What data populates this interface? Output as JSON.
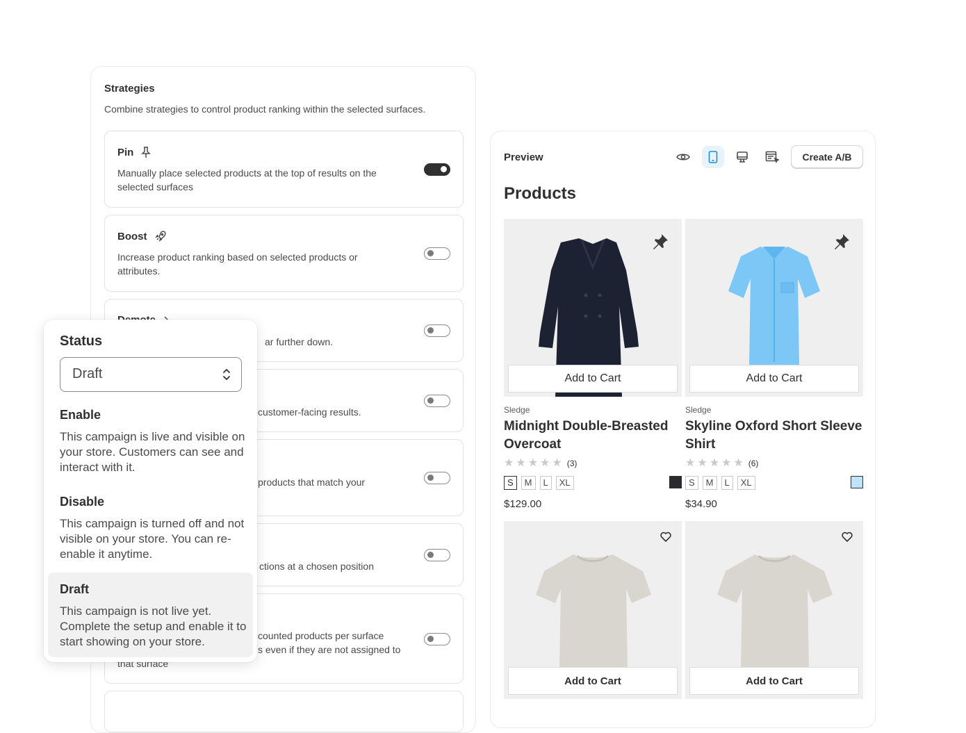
{
  "strategies": {
    "title": "Strategies",
    "subtitle": "Combine strategies to control product ranking within the selected surfaces.",
    "items": [
      {
        "name": "Pin",
        "icon": "pin-icon",
        "desc1": "Manually place selected products at the top of results on the",
        "desc2": "selected surfaces",
        "enabled": true
      },
      {
        "name": "Boost",
        "icon": "rocket-icon",
        "desc1": "Increase product ranking based on selected products or",
        "desc2": "attributes.",
        "enabled": false
      },
      {
        "name": "Demote",
        "icon": "demote-icon",
        "desc1": "ar further down.",
        "enabled": false
      },
      {
        "desc1": "customer-facing results.",
        "enabled": false
      },
      {
        "desc1": "products that match your",
        "enabled": false
      },
      {
        "desc1": "ctions at a chosen position",
        "enabled": false
      },
      {
        "desc1": "counted products per surface",
        "desc2": "s even if they are not assigned to",
        "desc3": "that surface",
        "enabled": false
      }
    ]
  },
  "status": {
    "label": "Status",
    "selected": "Draft",
    "options": [
      {
        "title": "Enable",
        "desc": "This campaign is live and visible on your store. Customers can see and interact with it."
      },
      {
        "title": "Disable",
        "desc": "This campaign is turned off and not visible on your store. You can re-enable it anytime."
      },
      {
        "title": "Draft",
        "desc": "This campaign is not live yet. Complete the setup and enable it to start showing on your store."
      }
    ]
  },
  "preview": {
    "title": "Preview",
    "tools": [
      "eye-icon",
      "mobile-icon",
      "desktop-icon",
      "storefront-icon"
    ],
    "active_tool": "mobile-icon",
    "ab_button": "Create A/B",
    "products_heading": "Products",
    "products": [
      {
        "vendor": "Sledge",
        "name": "Midnight Double-Breasted Overcoat",
        "rating_count": "(3)",
        "sizes": [
          "S",
          "M",
          "L",
          "XL"
        ],
        "selected_size": "S",
        "swatch": "#2b2b2f",
        "price": "$129.00",
        "cta": "Add to Cart"
      },
      {
        "vendor": "Sledge",
        "name": "Skyline Oxford Short Sleeve Shirt",
        "rating_count": "(6)",
        "sizes": [
          "S",
          "M",
          "L",
          "XL"
        ],
        "swatch": "#bfe3fb",
        "price": "$34.90",
        "cta": "Add to Cart"
      },
      {
        "cta": "Add to Cart"
      },
      {
        "cta": "Add to Cart"
      }
    ]
  }
}
